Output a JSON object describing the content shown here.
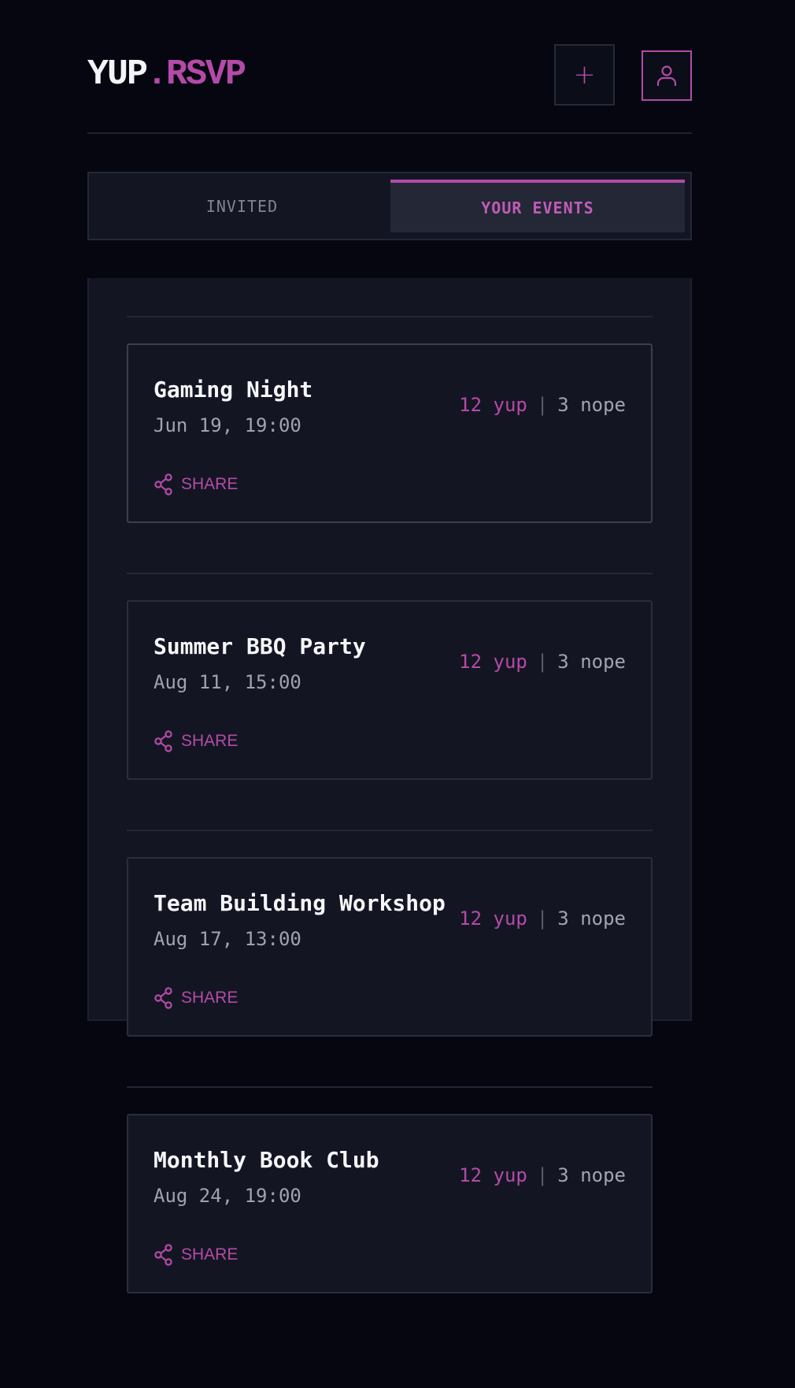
{
  "app": {
    "logo_part1": "YUP",
    "logo_part2": ".RSVP",
    "add_button_label": "+",
    "accent_color": "#b44aa8"
  },
  "tabs": [
    {
      "label": "INVITED",
      "active": false
    },
    {
      "label": "YOUR EVENTS",
      "active": true
    }
  ],
  "events": [
    {
      "title": "Gaming Night",
      "date": "Jun 19, 19:00",
      "yup": "12 yup",
      "separator": "|",
      "nope": "3 nope",
      "share_label": "SHARE"
    },
    {
      "title": "Summer BBQ Party",
      "date": "Aug 11, 15:00",
      "yup": "12 yup",
      "separator": "|",
      "nope": "3 nope",
      "share_label": "SHARE"
    },
    {
      "title": "Team Building Workshop",
      "date": "Aug 17, 13:00",
      "yup": "12 yup",
      "separator": "|",
      "nope": "3 nope",
      "share_label": "SHARE"
    },
    {
      "title": "Monthly Book Club",
      "date": "Aug 24, 19:00",
      "yup": "12 yup",
      "separator": "|",
      "nope": "3 nope",
      "share_label": "SHARE"
    }
  ],
  "icons": {
    "add": "plus-icon",
    "profile": "user-icon",
    "share": "share-icon"
  }
}
